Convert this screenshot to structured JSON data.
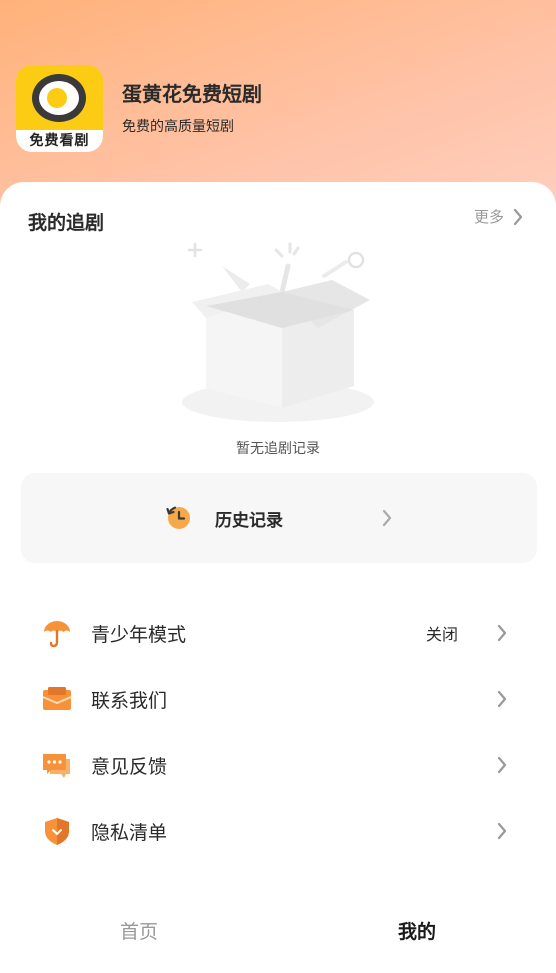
{
  "app": {
    "logo_text": "免费看剧",
    "name": "蛋黄花免费短剧",
    "slogan": "免费的高质量短剧"
  },
  "my_dramas": {
    "title": "我的追剧",
    "more_label": "更多",
    "empty_text": "暂无追剧记录"
  },
  "history": {
    "label": "历史记录"
  },
  "menu": {
    "items": [
      {
        "label": "青少年模式",
        "value": "关闭",
        "icon": "umbrella-icon"
      },
      {
        "label": "联系我们",
        "icon": "envelope-icon"
      },
      {
        "label": "意见反馈",
        "icon": "chat-bubble-icon"
      },
      {
        "label": "隐私清单",
        "icon": "shield-icon"
      }
    ]
  },
  "tabbar": {
    "tabs": [
      {
        "label": "首页",
        "active": false
      },
      {
        "label": "我的",
        "active": true
      }
    ]
  },
  "colors": {
    "accent": "#f7923a",
    "logo_yellow": "#fccc15",
    "header_gradient_start": "#ffb27a",
    "header_gradient_end": "#ffd2c4"
  }
}
